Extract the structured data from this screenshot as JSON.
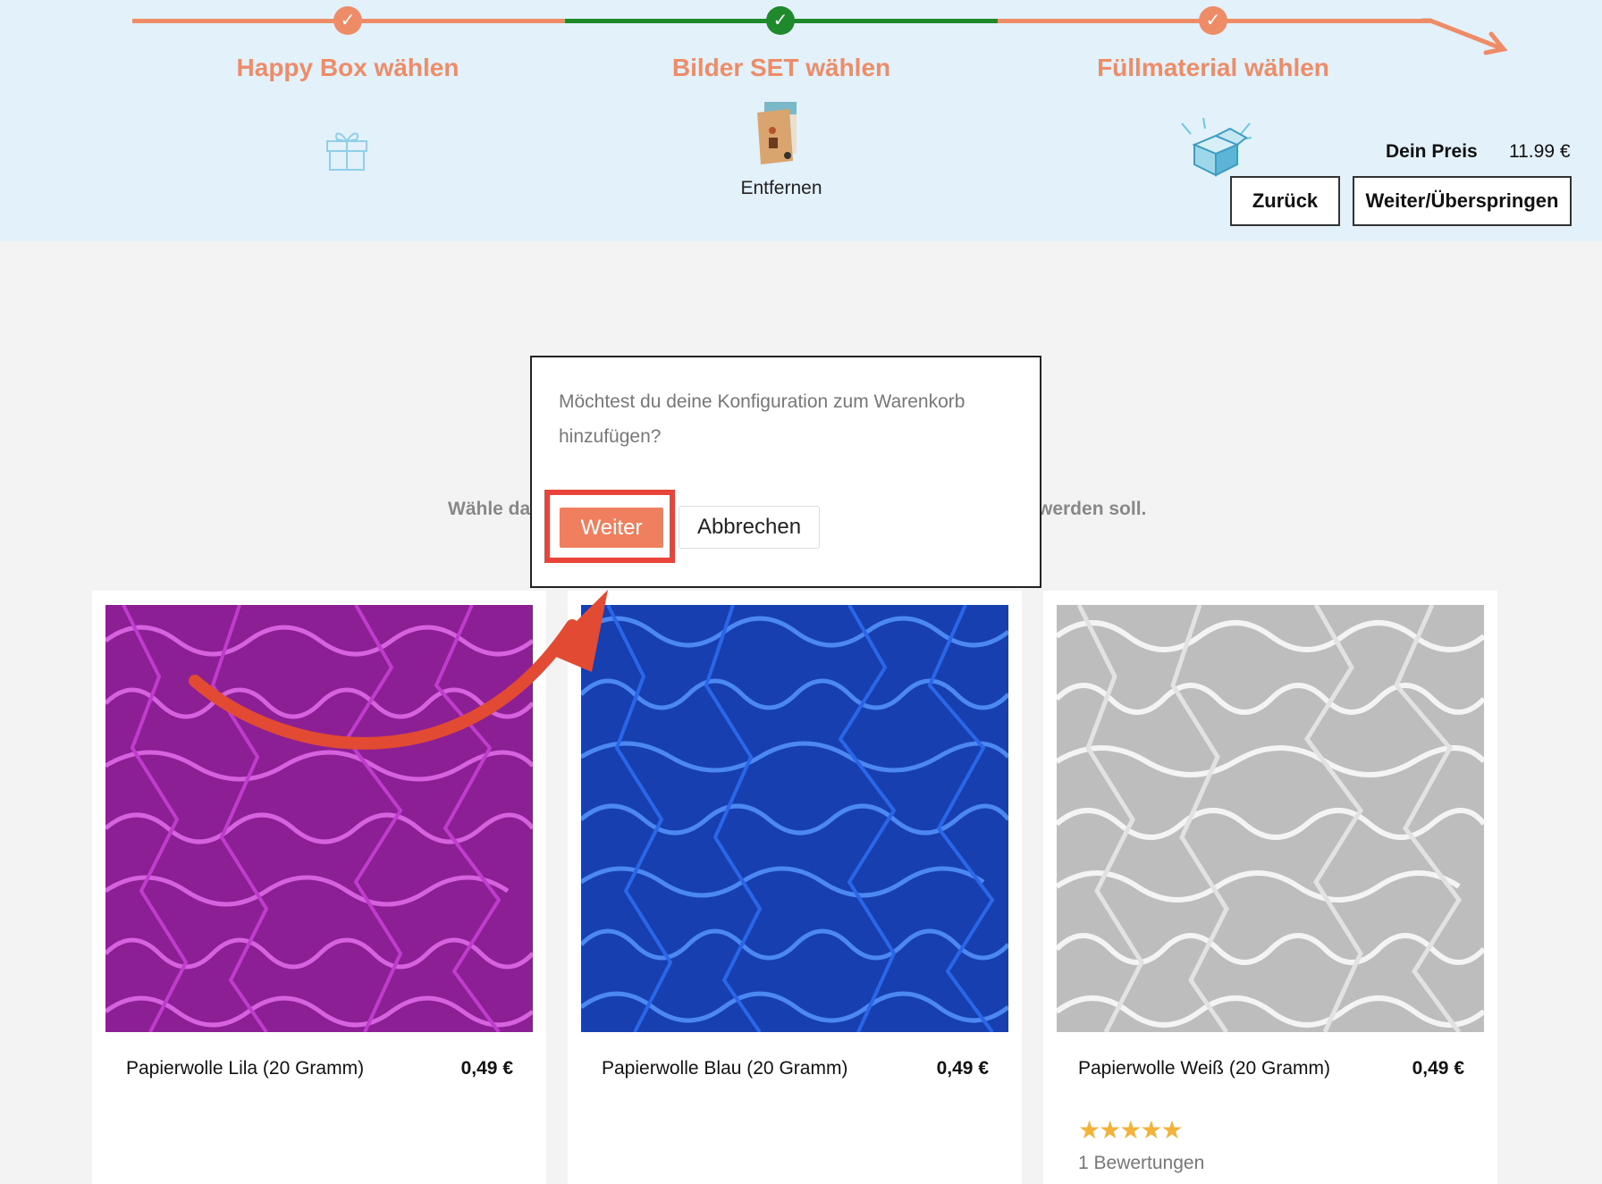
{
  "steps": [
    {
      "label": "Happy Box wählen",
      "icon": "gift-icon",
      "status": "done"
    },
    {
      "label": "Bilder SET wählen",
      "icon": "picture-set-icon",
      "status": "current"
    },
    {
      "label": "Füllmaterial wählen",
      "icon": "filler-box-icon",
      "status": "done"
    }
  ],
  "selected_set": {
    "remove_label": "Entfernen"
  },
  "price": {
    "label": "Dein Preis",
    "value": "11.99 €"
  },
  "nav": {
    "back_label": "Zurück",
    "next_label": "Weiter/Überspringen"
  },
  "content": {
    "subtitle_left": "Wähle da",
    "subtitle_right": "werden soll."
  },
  "products": [
    {
      "name": "Papierwolle Lila (20 Gramm)",
      "price": "0,49 €",
      "color": "#b42fc2"
    },
    {
      "name": "Papierwolle Blau (20 Gramm)",
      "price": "0,49 €",
      "color": "#2d5fe6"
    },
    {
      "name": "Papierwolle Weiß (20 Gramm)",
      "price": "0,49 €",
      "color": "#e2e2e2",
      "rating": 5,
      "reviews": "1 Bewertungen"
    }
  ],
  "dialog": {
    "message": "Möchtest du deine Konfiguration zum Warenkorb hinzufügen?",
    "confirm_label": "Weiter",
    "cancel_label": "Abbrechen"
  },
  "colors": {
    "accent": "#ef8c68",
    "progress_done": "#ef8c68",
    "progress_current": "#1e8a2c",
    "highlight": "#e8443a",
    "band_bg": "#e3f1fb"
  }
}
